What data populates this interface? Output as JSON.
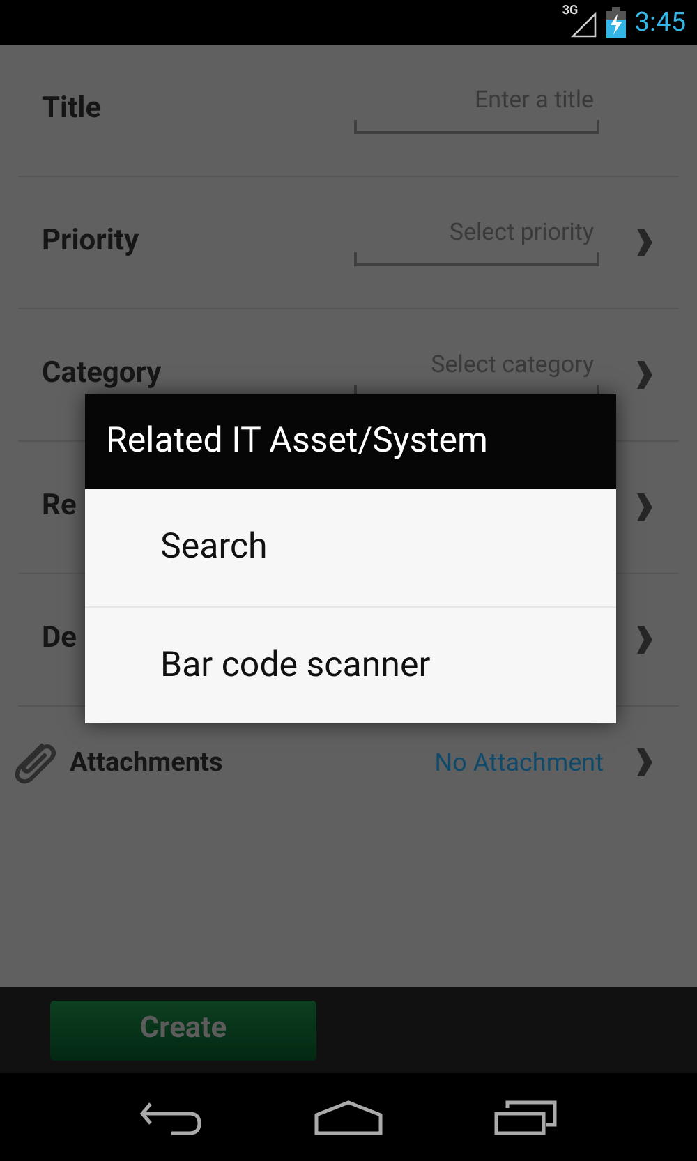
{
  "status_bar": {
    "network": "3G",
    "time": "3:45"
  },
  "form": {
    "rows": [
      {
        "kind": "text",
        "label": "Title",
        "placeholder": "Enter a title"
      },
      {
        "kind": "select",
        "label": "Priority",
        "placeholder": "Select priority"
      },
      {
        "kind": "select",
        "label": "Category",
        "placeholder": "Select category"
      },
      {
        "kind": "covered",
        "label": "Re"
      },
      {
        "kind": "covered",
        "label": "De"
      }
    ],
    "attachments": {
      "label": "Attachments",
      "value": "No Attachment"
    }
  },
  "dialog": {
    "title": "Related IT Asset/System",
    "options": [
      "Search",
      "Bar code scanner"
    ]
  },
  "create_button": {
    "label": "Create"
  }
}
